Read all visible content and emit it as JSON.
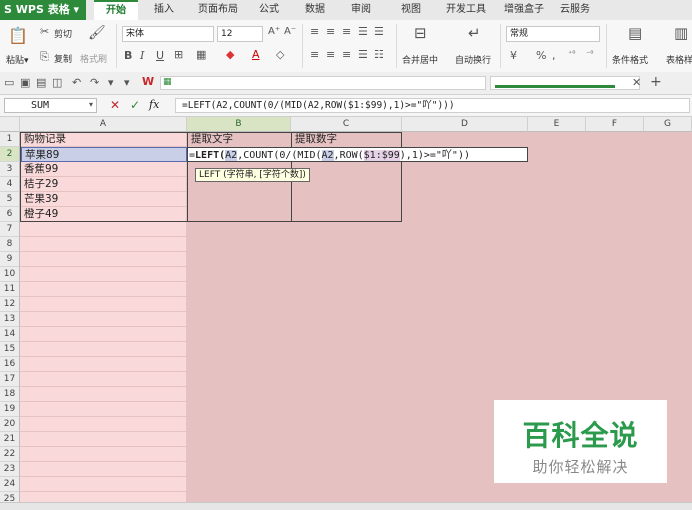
{
  "app": {
    "name": "S WPS 表格",
    "name_arrow": "▾"
  },
  "tabs": [
    "开始",
    "插入",
    "页面布局",
    "公式",
    "数据",
    "审阅",
    "视图",
    "开发工具",
    "增强盒子",
    "云服务"
  ],
  "ribbon": {
    "paste": "粘贴",
    "paste_arrow": "▾",
    "cut": "剪切",
    "copy": "复制",
    "format_painter": "格式刷",
    "font_name": "宋体",
    "font_size": "12",
    "grow_font": "A⁺",
    "shrink_font": "A⁻",
    "bold": "B",
    "italic": "I",
    "underline": "U",
    "merge_center": "合并居中",
    "wrap_text": "自动换行",
    "number_format": "常规",
    "percent": "%",
    "comma": ",",
    "conditional_format": "条件格式",
    "table_style": "表格样"
  },
  "formula_bar": {
    "name_box": "SUM",
    "cancel_icon": "✕",
    "confirm_icon": "✓",
    "fx": "fx",
    "formula": "=LEFT(A2,COUNT(0/(MID(A2,ROW($1:$99),1)>=\"吖\")))"
  },
  "columns": [
    "A",
    "B",
    "C",
    "D",
    "E",
    "F",
    "G"
  ],
  "rows": [
    "1",
    "2",
    "3",
    "4",
    "5",
    "6",
    "7",
    "8",
    "9",
    "10",
    "11",
    "12",
    "13",
    "14",
    "15",
    "16",
    "17",
    "18",
    "19",
    "20",
    "21",
    "22",
    "23",
    "24",
    "25"
  ],
  "cells": {
    "A1": "购物记录",
    "B1": "提取文字",
    "C1": "提取数字",
    "A2": "苹果89",
    "A3": "香蕉99",
    "A4": "桔子29",
    "A5": "芒果39",
    "A6": "橙子49"
  },
  "edit": {
    "prefix": "=",
    "fn": "LEFT",
    "open": "(",
    "ref1": "A2",
    "mid1": ",COUNT(0/(MID(",
    "ref2": "A2",
    "mid2": ",ROW(",
    "ref3": "$1:$99",
    "tail": "),1)>=\"吖\"))"
  },
  "tooltip": "LEFT (字符串, [字符个数])",
  "watermark": {
    "title": "百科全说",
    "subtitle": "助你轻松解决"
  },
  "colors": {
    "brand": "#2c8a3a",
    "cell_bg": "#f9d9d9",
    "selected": "#c9cfe6",
    "watermark": "#2b9a4c"
  }
}
